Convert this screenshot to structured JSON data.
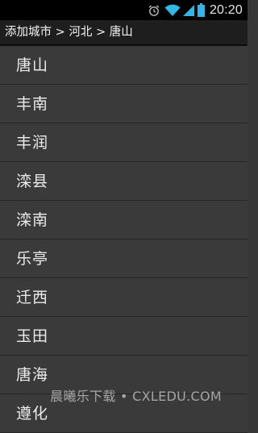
{
  "status_bar": {
    "time": "20:20",
    "icons": [
      "alarm-icon",
      "wifi-icon",
      "signal-icon",
      "battery-icon"
    ],
    "accent_color": "#33b5e5"
  },
  "header": {
    "breadcrumb": "添加城市 > 河北 > 唐山"
  },
  "list": {
    "items": [
      {
        "label": "唐山"
      },
      {
        "label": "丰南"
      },
      {
        "label": "丰润"
      },
      {
        "label": "滦县"
      },
      {
        "label": "滦南"
      },
      {
        "label": "乐亭"
      },
      {
        "label": "迁西"
      },
      {
        "label": "玉田"
      },
      {
        "label": "唐海"
      },
      {
        "label": "遵化"
      }
    ]
  },
  "watermark": "晨曦乐下载 • CXLEDU.COM"
}
